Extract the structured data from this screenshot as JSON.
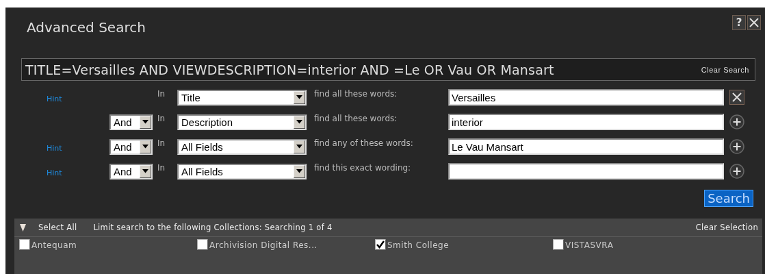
{
  "window": {
    "title": "Advanced Search",
    "buttons": [
      {
        "kind": "help",
        "label": "?"
      },
      {
        "kind": "close"
      }
    ]
  },
  "query": {
    "text": "TITLE=Versailles AND VIEWDESCRIPTION=interior AND =Le OR Vau OR Mansart",
    "clear": "Clear Search"
  },
  "rows": [
    {
      "hint": "Hint",
      "in": "In",
      "field": "Title",
      "match": "find all these words:",
      "value": "Versailles",
      "kind": "remove"
    },
    {
      "operator": "And",
      "in": "In",
      "field": "Description",
      "match": "find all these words:",
      "value": "interior",
      "kind": "add"
    },
    {
      "hint": "Hint",
      "operator": "And",
      "in": "In",
      "field": "All Fields",
      "match": "find any of these words:",
      "value": "Le Vau Mansart",
      "kind": "add"
    },
    {
      "hint": "Hint",
      "operator": "And",
      "in": "In",
      "field": "All Fields",
      "match": "find this exact wording:",
      "kind": "add"
    }
  ],
  "search_button": "Search",
  "collections": {
    "select_all": "Select All",
    "summary": "Limit search to the following Collections: Searching 1 of 4",
    "clear": "Clear Selection",
    "items": [
      {
        "label": "Antequam",
        "checked": false
      },
      {
        "label": "Archivision Digital Res...",
        "checked": false
      },
      {
        "label": "Smith College",
        "checked": true
      },
      {
        "label": "VISTASVRA",
        "checked": false
      }
    ]
  }
}
